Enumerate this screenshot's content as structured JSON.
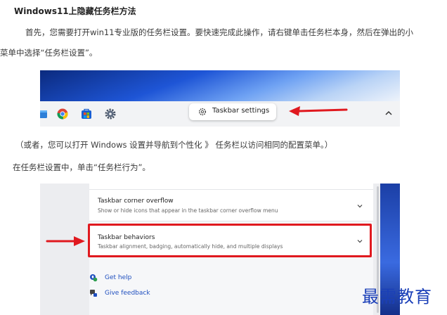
{
  "article": {
    "title": "Windows11上隐藏任务栏方法",
    "para1_line1": "首先，您需要打开win11专业版的任务栏设置。要快速完成此操作，请右键单击任务栏本身，然后在弹出的小",
    "para1_line2": "菜单中选择“任务栏设置”。",
    "para2": "（或者，您可以打开 Windows 设置并导航到个性化 》 任务栏以访问相同的配置菜单。）",
    "para3": "在任务栏设置中，单击“任务栏行为”。"
  },
  "screenshot1": {
    "context_menu_item": "Taskbar settings",
    "taskbar_icons": [
      "file-explorer-icon",
      "chrome-icon",
      "store-icon",
      "settings-icon"
    ],
    "arrow_color": "#e0191f"
  },
  "screenshot2": {
    "cards": [
      {
        "title": "Taskbar corner overflow",
        "subtitle": "Show or hide icons that appear in the taskbar corner overflow menu"
      },
      {
        "title": "Taskbar behaviors",
        "subtitle": "Taskbar alignment, badging, automatically hide, and multiple displays"
      }
    ],
    "links": [
      "Get help",
      "Give feedback"
    ],
    "highlight_color": "#e0191f"
  },
  "watermark": "最需教育"
}
